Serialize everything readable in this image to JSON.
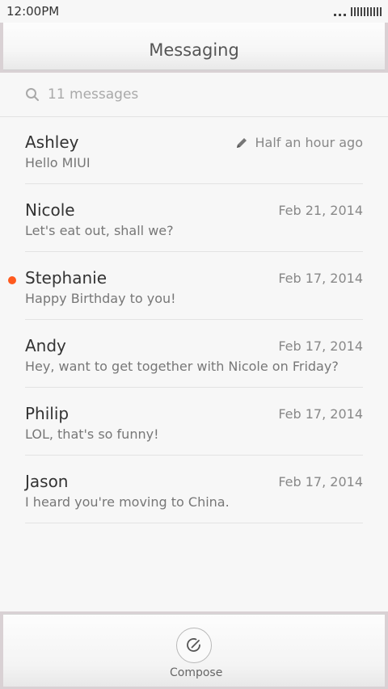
{
  "status_bar": {
    "time": "12:00PM",
    "battery_icon": "battery-icon",
    "signal_icon": "signal-dots-icon"
  },
  "header": {
    "title": "Messaging"
  },
  "search": {
    "placeholder": "11 messages",
    "icon": "search-icon"
  },
  "messages": [
    {
      "name": "Ashley",
      "preview": "Hello MIUI",
      "date": "Half an hour ago",
      "draft": true,
      "unread": false
    },
    {
      "name": "Nicole",
      "preview": "Let's eat out, shall we?",
      "date": "Feb 21, 2014",
      "draft": false,
      "unread": false
    },
    {
      "name": "Stephanie",
      "preview": "Happy Birthday to you!",
      "date": "Feb 17, 2014",
      "draft": false,
      "unread": true
    },
    {
      "name": "Andy",
      "preview": "Hey, want to get together with Nicole on Friday?",
      "date": "Feb 17, 2014",
      "draft": false,
      "unread": false
    },
    {
      "name": "Philip",
      "preview": "LOL, that's so funny!",
      "date": "Feb 17, 2014",
      "draft": false,
      "unread": false
    },
    {
      "name": "Jason",
      "preview": "I heard you're moving to China.",
      "date": "Feb 17, 2014",
      "draft": false,
      "unread": false
    }
  ],
  "bottom_bar": {
    "compose_label": "Compose",
    "compose_icon": "compose-icon"
  },
  "colors": {
    "unread_dot": "#ff5a1e",
    "background": "#f7f7f7"
  }
}
